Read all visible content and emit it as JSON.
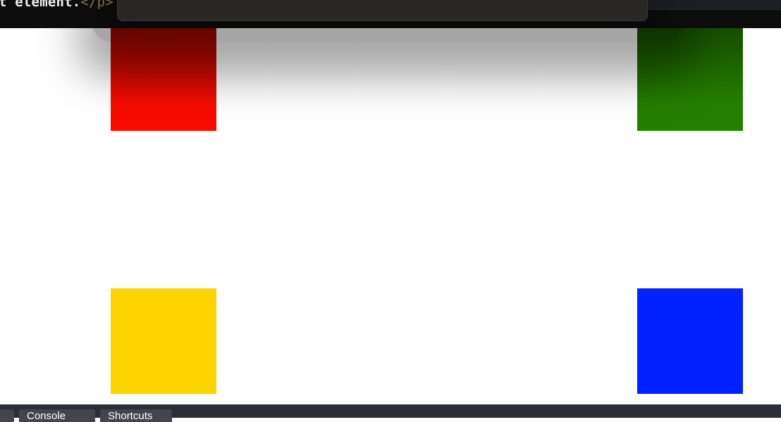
{
  "editor": {
    "code_text": "t element.",
    "code_tag": "</p>"
  },
  "preview": {
    "boxes": [
      {
        "name": "red",
        "color": "#f80c00"
      },
      {
        "name": "green",
        "color": "#247f00"
      },
      {
        "name": "yellow",
        "color": "#fdd300"
      },
      {
        "name": "blue",
        "color": "#0022ff"
      }
    ]
  },
  "toolbar": {
    "tab_left": "",
    "tab_console": "Console",
    "tab_shortcuts": "Shortcuts"
  }
}
